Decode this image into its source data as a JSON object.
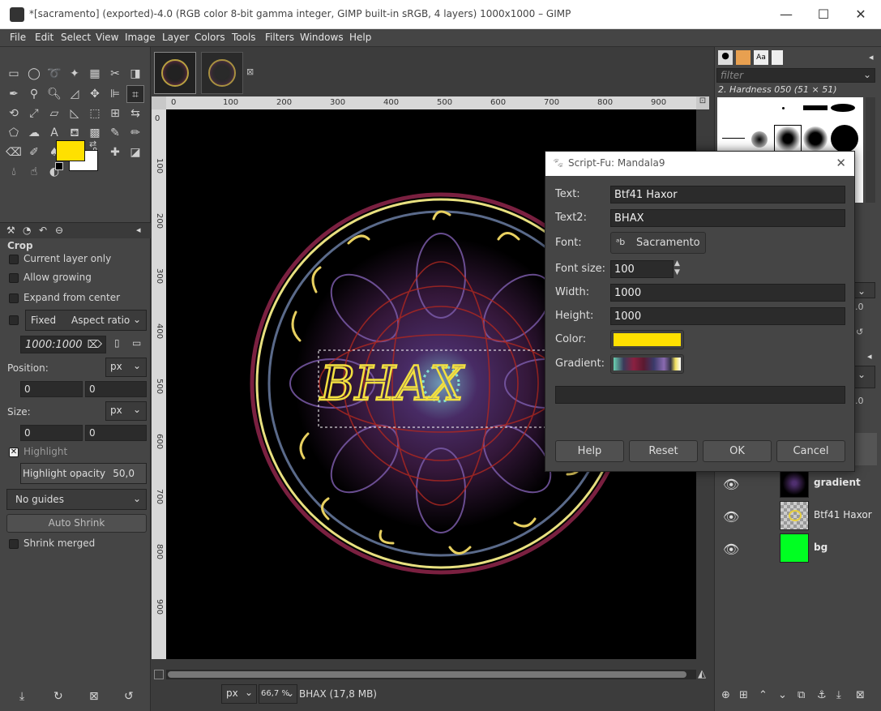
{
  "window": {
    "title": "*[sacramento] (exported)-4.0 (RGB color 8-bit gamma integer, GIMP built-in sRGB, 4 layers) 1000x1000 – GIMP",
    "minimize": "—",
    "maximize": "☐",
    "close": "✕"
  },
  "menu": [
    "File",
    "Edit",
    "Select",
    "View",
    "Image",
    "Layer",
    "Colors",
    "Tools",
    "Filters",
    "Windows",
    "Help"
  ],
  "tool_options": {
    "title": "Crop",
    "current_layer_only": "Current layer only",
    "allow_growing": "Allow growing",
    "expand_from_center": "Expand from center",
    "fixed": "Fixed",
    "aspect_ratio": "Aspect ratio",
    "ratio_value": "1000:1000",
    "position_label": "Position:",
    "position_unit": "px",
    "position_x": "0",
    "position_y": "0",
    "size_label": "Size:",
    "size_unit": "px",
    "size_w": "0",
    "size_h": "0",
    "highlight": "Highlight",
    "highlight_opacity_label": "Highlight opacity",
    "highlight_opacity_value": "50,0",
    "guides": "No guides",
    "auto_shrink": "Auto Shrink",
    "shrink_merged": "Shrink merged"
  },
  "colors": {
    "foreground": "#ffe000",
    "background": "#ffffff"
  },
  "canvas": {
    "ruler_ticks": [
      "0",
      "100",
      "200",
      "300",
      "400",
      "500",
      "600",
      "700",
      "800",
      "900"
    ],
    "vertical_ticks": [
      "0",
      "100",
      "200",
      "300",
      "400",
      "500",
      "600",
      "700",
      "800",
      "900"
    ],
    "canvas_text": "BHAX"
  },
  "status": {
    "unit": "px",
    "zoom": "66,7 %",
    "info": "BHAX (17,8 MB)"
  },
  "brushes": {
    "filter_placeholder": "filter",
    "brush_name": "2. Hardness 050 (51 × 51)"
  },
  "layers": [
    {
      "name": "gradient",
      "bold": true
    },
    {
      "name": "Btf41 Haxor",
      "bold": false
    },
    {
      "name": "bg",
      "bold": true
    }
  ],
  "dialog": {
    "title": "Script-Fu: Mandala9",
    "text_label": "Text:",
    "text_value": "Btf41 Haxor",
    "text2_label": "Text2:",
    "text2_value": "BHAX",
    "font_label": "Font:",
    "font_value": "Sacramento",
    "fontsize_label": "Font size:",
    "fontsize_value": "100",
    "width_label": "Width:",
    "width_value": "1000",
    "height_label": "Height:",
    "height_value": "1000",
    "color_label": "Color:",
    "gradient_label": "Gradient:",
    "color_value": "#ffe000",
    "help": "Help",
    "reset": "Reset",
    "ok": "OK",
    "cancel": "Cancel"
  }
}
